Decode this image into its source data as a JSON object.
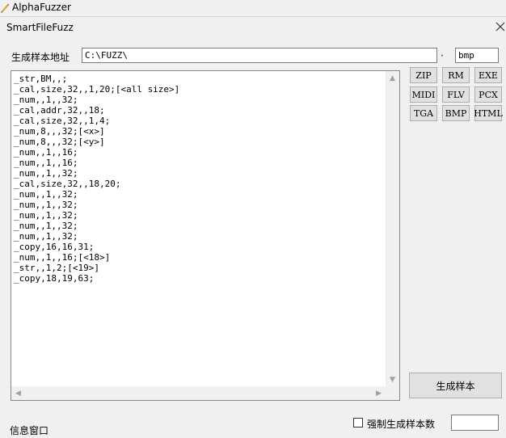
{
  "window": {
    "title": "AlphaFuzzer"
  },
  "panel": {
    "title": "SmartFileFuzz"
  },
  "form": {
    "path_label": "生成样本地址",
    "path_value": "C:\\FUZZ\\",
    "ext_sep": "·",
    "ext_value": "bmp"
  },
  "editor": {
    "lines": [
      "_str,BM,,;",
      "_cal,size,32,,1,20;[<all size>]",
      "_num,,1,,32;",
      "_cal,addr,32,,18;",
      "_cal,size,32,,1,4;",
      "_num,8,,,32;[<x>]",
      "_num,8,,,32;[<y>]",
      "_num,,1,,16;",
      "_num,,1,,16;",
      "_num,,1,,32;",
      "_cal,size,32,,18,20;",
      "_num,,1,,32;",
      "_num,,1,,32;",
      "_num,,1,,32;",
      "_num,,1,,32;",
      "_num,,1,,32;",
      "_copy,16,16,31;",
      "_num,,1,,16;[<18>]",
      "_str,,1,2;[<19>]",
      "_copy,18,19,63;"
    ]
  },
  "file_types": {
    "row1": [
      "ZIP",
      "RM",
      "EXE"
    ],
    "row2": [
      "MIDI",
      "FLV",
      "PCX"
    ],
    "row3": [
      "TGA",
      "BMP",
      "HTML"
    ]
  },
  "generate_label": "生成样本",
  "info_label": "信息窗口",
  "force_count_label": "强制生成样本数",
  "force_count_value": ""
}
